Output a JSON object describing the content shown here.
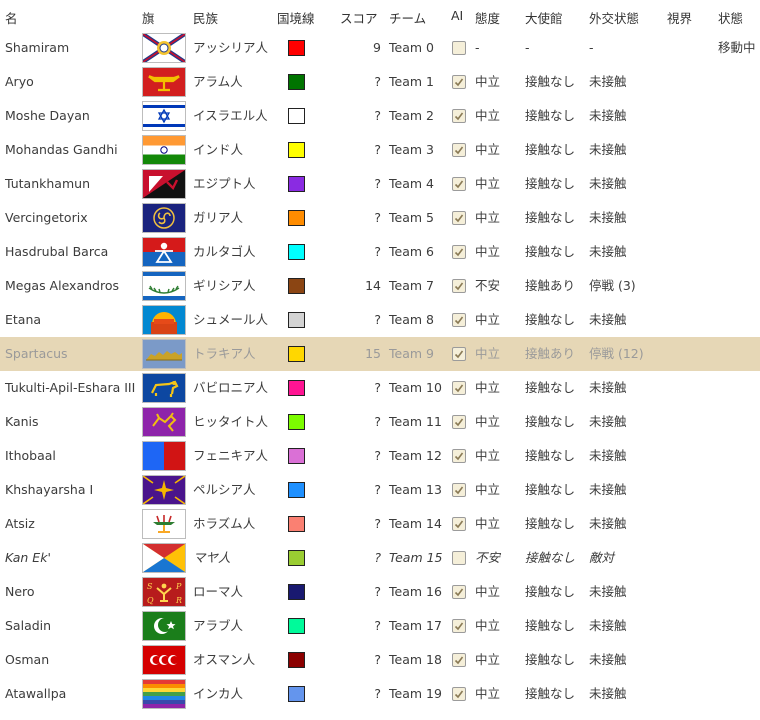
{
  "headers": {
    "name": "名",
    "flag": "旗",
    "civ": "民族",
    "border": "国境線",
    "score": "スコア",
    "team": "チーム",
    "ai": "AI",
    "attitude": "態度",
    "embassy": "大使館",
    "diplomacy": "外交状態",
    "vision": "視界",
    "status": "状態"
  },
  "rows": [
    {
      "name": "Shamiram",
      "flag": "assyria-flag",
      "civ": "アッシリア人",
      "color": "#ff0000",
      "score": "9",
      "team": "Team 0",
      "ai": false,
      "attitude": "-",
      "embassy": "-",
      "diplomacy": "-",
      "vision": "",
      "status": "移動中"
    },
    {
      "name": "Aryo",
      "flag": "aram-flag",
      "civ": "アラム人",
      "color": "#007400",
      "score": "?",
      "team": "Team 1",
      "ai": true,
      "attitude": "中立",
      "embassy": "接触なし",
      "diplomacy": "未接触",
      "vision": "",
      "status": ""
    },
    {
      "name": "Moshe Dayan",
      "flag": "israel-flag",
      "civ": "イスラエル人",
      "color": "#ffffff",
      "score": "?",
      "team": "Team 2",
      "ai": true,
      "attitude": "中立",
      "embassy": "接触なし",
      "diplomacy": "未接触",
      "vision": "",
      "status": ""
    },
    {
      "name": "Mohandas Gandhi",
      "flag": "india-flag",
      "civ": "インド人",
      "color": "#ffff00",
      "score": "?",
      "team": "Team 3",
      "ai": true,
      "attitude": "中立",
      "embassy": "接触なし",
      "diplomacy": "未接触",
      "vision": "",
      "status": ""
    },
    {
      "name": "Tutankhamun",
      "flag": "egypt-flag",
      "civ": "エジプト人",
      "color": "#8a2be2",
      "score": "?",
      "team": "Team 4",
      "ai": true,
      "attitude": "中立",
      "embassy": "接触なし",
      "diplomacy": "未接触",
      "vision": "",
      "status": ""
    },
    {
      "name": "Vercingetorix",
      "flag": "gaul-flag",
      "civ": "ガリア人",
      "color": "#ff8c00",
      "score": "?",
      "team": "Team 5",
      "ai": true,
      "attitude": "中立",
      "embassy": "接触なし",
      "diplomacy": "未接触",
      "vision": "",
      "status": ""
    },
    {
      "name": "Hasdrubal Barca",
      "flag": "carthage-flag",
      "civ": "カルタゴ人",
      "color": "#00ffff",
      "score": "?",
      "team": "Team 6",
      "ai": true,
      "attitude": "中立",
      "embassy": "接触なし",
      "diplomacy": "未接触",
      "vision": "",
      "status": ""
    },
    {
      "name": "Megas Alexandros",
      "flag": "greece-flag",
      "civ": "ギリシア人",
      "color": "#8b4513",
      "score": "14",
      "team": "Team 7",
      "ai": true,
      "attitude": "不安",
      "embassy": "接触あり",
      "diplomacy": "停戦 (3)",
      "vision": "",
      "status": ""
    },
    {
      "name": "Etana",
      "flag": "sumer-flag",
      "civ": "シュメール人",
      "color": "#d3d3d3",
      "score": "?",
      "team": "Team 8",
      "ai": true,
      "attitude": "中立",
      "embassy": "接触なし",
      "diplomacy": "未接触",
      "vision": "",
      "status": ""
    },
    {
      "name": "Spartacus",
      "flag": "thrace-flag",
      "civ": "トラキア人",
      "color": "#ffd700",
      "score": "15",
      "team": "Team 9",
      "ai": true,
      "attitude": "中立",
      "embassy": "接触あり",
      "diplomacy": "停戦 (12)",
      "vision": "",
      "status": "",
      "selected": true
    },
    {
      "name": "Tukulti-Apil-Eshara III",
      "flag": "babylon-flag",
      "civ": "バビロニア人",
      "color": "#ff1493",
      "score": "?",
      "team": "Team 10",
      "ai": true,
      "attitude": "中立",
      "embassy": "接触なし",
      "diplomacy": "未接触",
      "vision": "",
      "status": ""
    },
    {
      "name": "Kanis",
      "flag": "hittite-flag",
      "civ": "ヒッタイト人",
      "color": "#7cfc00",
      "score": "?",
      "team": "Team 11",
      "ai": true,
      "attitude": "中立",
      "embassy": "接触なし",
      "diplomacy": "未接触",
      "vision": "",
      "status": ""
    },
    {
      "name": "Ithobaal",
      "flag": "phoenicia-flag",
      "civ": "フェニキア人",
      "color": "#da70d6",
      "score": "?",
      "team": "Team 12",
      "ai": true,
      "attitude": "中立",
      "embassy": "接触なし",
      "diplomacy": "未接触",
      "vision": "",
      "status": ""
    },
    {
      "name": "Khshayarsha I",
      "flag": "persia-flag",
      "civ": "ペルシア人",
      "color": "#1e90ff",
      "score": "?",
      "team": "Team 13",
      "ai": true,
      "attitude": "中立",
      "embassy": "接触なし",
      "diplomacy": "未接触",
      "vision": "",
      "status": ""
    },
    {
      "name": "Atsiz",
      "flag": "khwarezm-flag",
      "civ": "ホラズム人",
      "color": "#fa8072",
      "score": "?",
      "team": "Team 14",
      "ai": true,
      "attitude": "中立",
      "embassy": "接触なし",
      "diplomacy": "未接触",
      "vision": "",
      "status": ""
    },
    {
      "name": "Kan Ek'",
      "flag": "maya-flag",
      "civ": "マヤ人",
      "color": "#9acd32",
      "score": "?",
      "team": "Team 15",
      "ai": false,
      "attitude": "不安",
      "embassy": "接触なし",
      "diplomacy": "敵対",
      "vision": "",
      "status": "",
      "italic": true
    },
    {
      "name": "Nero",
      "flag": "rome-flag",
      "civ": "ローマ人",
      "color": "#191970",
      "score": "?",
      "team": "Team 16",
      "ai": true,
      "attitude": "中立",
      "embassy": "接触なし",
      "diplomacy": "未接触",
      "vision": "",
      "status": ""
    },
    {
      "name": "Saladin",
      "flag": "arab-flag",
      "civ": "アラブ人",
      "color": "#00fa9a",
      "score": "?",
      "team": "Team 17",
      "ai": true,
      "attitude": "中立",
      "embassy": "接触なし",
      "diplomacy": "未接触",
      "vision": "",
      "status": ""
    },
    {
      "name": "Osman",
      "flag": "ottoman-flag",
      "civ": "オスマン人",
      "color": "#8b0000",
      "score": "?",
      "team": "Team 18",
      "ai": true,
      "attitude": "中立",
      "embassy": "接触なし",
      "diplomacy": "未接触",
      "vision": "",
      "status": ""
    },
    {
      "name": "Atawallpa",
      "flag": "inca-flag",
      "civ": "インカ人",
      "color": "#6495ed",
      "score": "?",
      "team": "Team 19",
      "ai": true,
      "attitude": "中立",
      "embassy": "接触なし",
      "diplomacy": "未接触",
      "vision": "",
      "status": ""
    }
  ],
  "rome_flag_letters": [
    "S",
    "P",
    "Q",
    "R"
  ]
}
